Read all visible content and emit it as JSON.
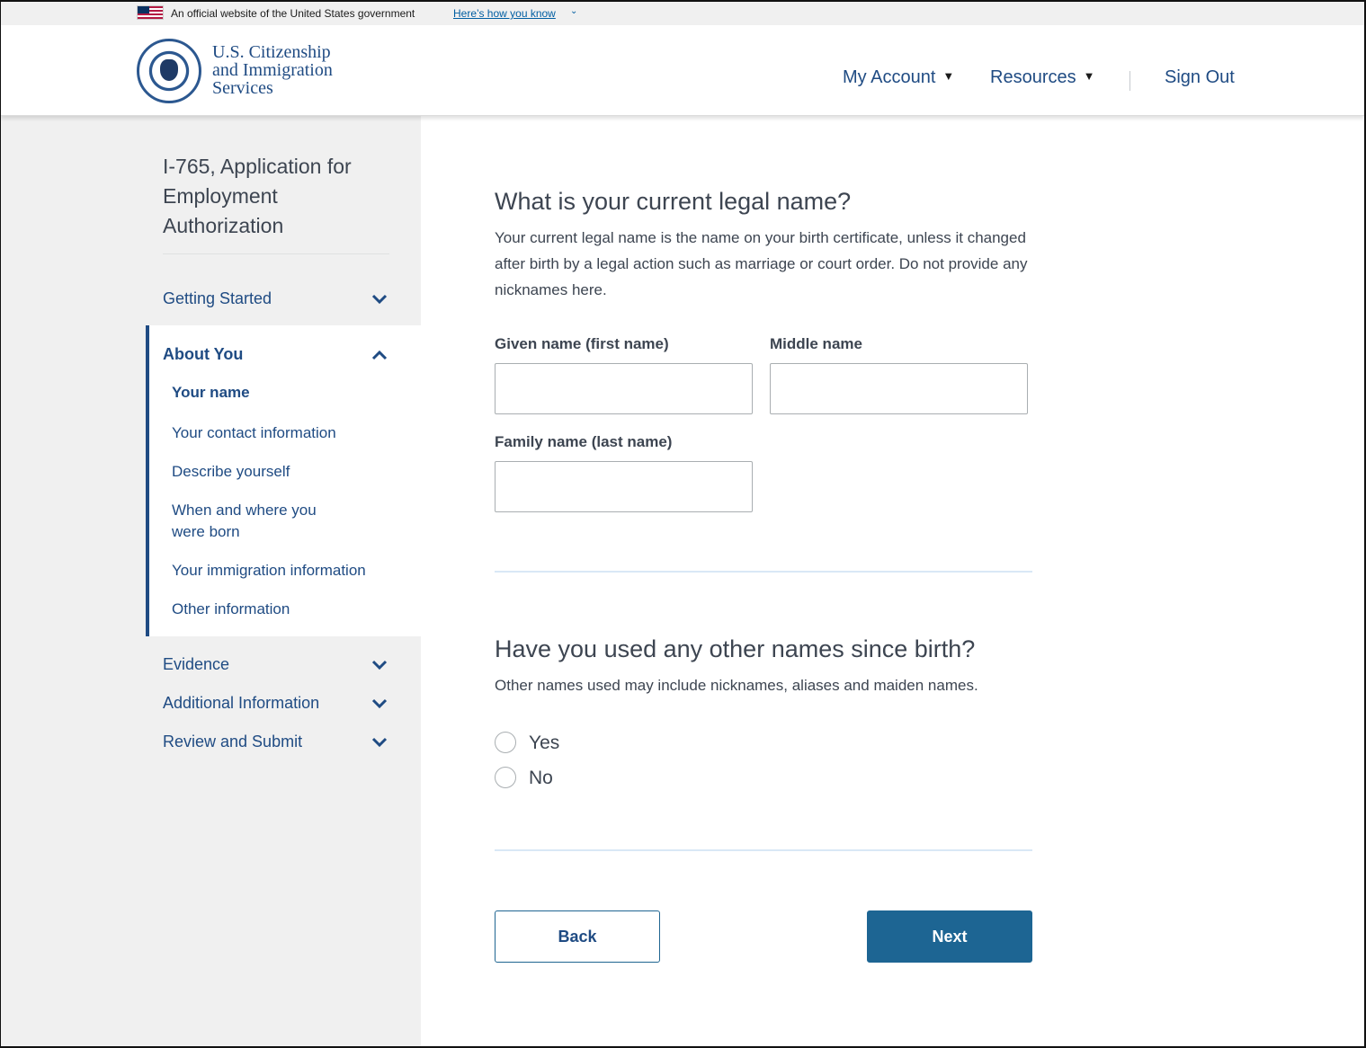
{
  "banner": {
    "official_text": "An official website of the United States government",
    "how_link": "Here’s how you know",
    "chevron": "⌄"
  },
  "header": {
    "agency_line1": "U.S. Citizenship",
    "agency_line2": "and Immigration",
    "agency_line3": "Services",
    "nav": {
      "my_account": "My Account",
      "resources": "Resources",
      "sign_out": "Sign Out",
      "caret": "▼"
    }
  },
  "sidebar": {
    "form_title": "I-765, Application for Employment Authorization",
    "sections": {
      "getting_started": "Getting Started",
      "about_you": "About You",
      "evidence": "Evidence",
      "additional_information": "Additional Information",
      "review_and_submit": "Review and Submit"
    },
    "about_you_items": [
      "Your name",
      "Your contact information",
      "Describe yourself",
      "When and where you were born",
      "Your immigration information",
      "Other information"
    ]
  },
  "main": {
    "q1_title": "What is your current legal name?",
    "q1_help": "Your current legal name is the name on your birth certificate, unless it changed after birth by a legal action such as marriage or court order. Do not provide any nicknames here.",
    "fields": {
      "given_label": "Given name (first name)",
      "given_value": "",
      "middle_label": "Middle name",
      "middle_value": "",
      "family_label": "Family name (last name)",
      "family_value": ""
    },
    "q2_title": "Have you used any other names since birth?",
    "q2_help": "Other names used may include nicknames, aliases and maiden names.",
    "radio_yes": "Yes",
    "radio_no": "No",
    "back_button": "Back",
    "next_button": "Next"
  },
  "colors": {
    "primary": "#1f4b83",
    "button": "#1d6593",
    "sidebar_bg": "#f0f0f0",
    "rule": "#d9e8f6"
  }
}
